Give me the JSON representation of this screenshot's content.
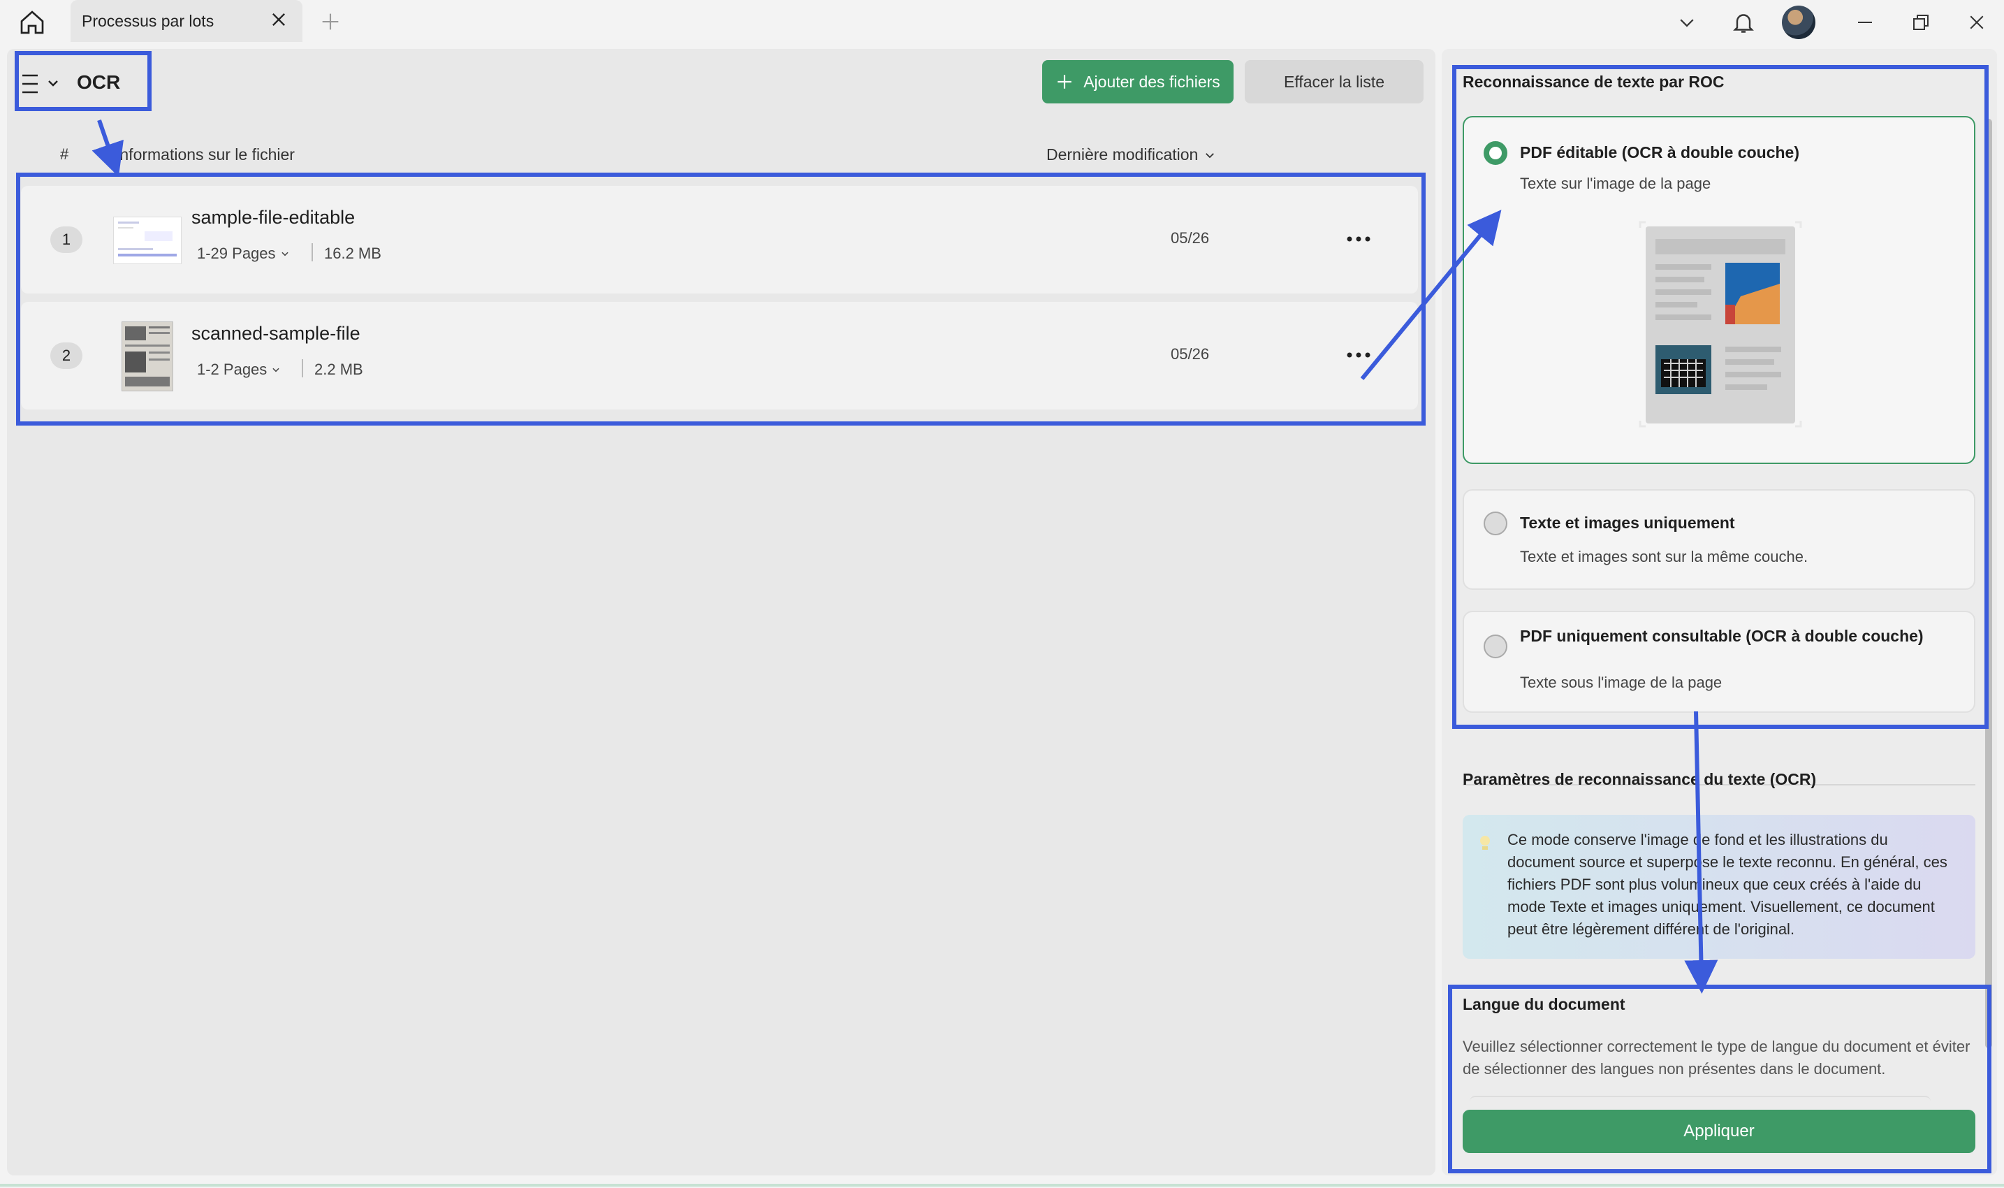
{
  "tab": {
    "title": "Processus par lots"
  },
  "toolbar": {
    "mode_title": "OCR",
    "add_files": "Ajouter des fichiers",
    "clear_list": "Effacer la liste"
  },
  "columns": {
    "number": "#",
    "file_info": "Informations sur le fichier",
    "last_modified": "Dernière modification"
  },
  "files": [
    {
      "index": "1",
      "name": "sample-file-editable",
      "pages": "1-29 Pages",
      "size": "16.2 MB",
      "date": "05/26"
    },
    {
      "index": "2",
      "name": "scanned-sample-file",
      "pages": "1-2 Pages",
      "size": "2.2 MB",
      "date": "05/26"
    }
  ],
  "ocr_panel": {
    "heading": "Reconnaissance de texte par ROC",
    "options": [
      {
        "title": "PDF éditable (OCR à double couche)",
        "desc": "Texte sur l'image de la page",
        "selected": true
      },
      {
        "title": "Texte et images uniquement",
        "desc": "Texte et images sont sur la même couche.",
        "selected": false
      },
      {
        "title": "PDF uniquement consultable (OCR à double couche)",
        "desc": "Texte sous l'image de la page",
        "selected": false
      }
    ],
    "params_heading": "Paramètres de reconnaissance du texte (OCR)",
    "info_text": "Ce mode conserve l'image de fond et les illustrations du document source et superpose le texte reconnu. En général, ces fichiers PDF sont plus volumineux que ceux créés à l'aide du mode Texte et images uniquement. Visuellement, ce document peut être légèrement différent de l'original.",
    "language_heading": "Langue du document",
    "language_desc": "Veuillez sélectionner correctement le type de langue du document et éviter de sélectionner des langues non présentes dans le document.",
    "apply": "Appliquer"
  },
  "colors": {
    "accent": "#3e9a66",
    "annotation": "#3b5bdb"
  }
}
